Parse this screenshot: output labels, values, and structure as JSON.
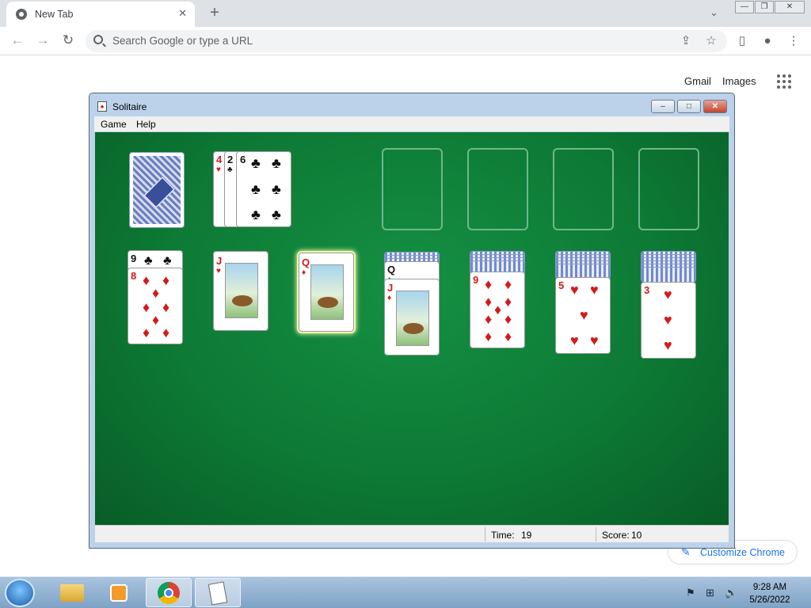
{
  "browser": {
    "tab_title": "New Tab",
    "tab_close": "✕",
    "new_tab": "+",
    "omnibox_placeholder": "Search Google or type a URL",
    "ntp_links": [
      "Gmail",
      "Images"
    ],
    "customize_label": "Customize Chrome"
  },
  "solitaire": {
    "title": "Solitaire",
    "menu": [
      "Game",
      "Help"
    ],
    "status": {
      "time_label": "Time:",
      "time_value": "19",
      "score_label": "Score:",
      "score_value": "10"
    },
    "waste": [
      {
        "rank": "4",
        "suit": "♥",
        "color": "red"
      },
      {
        "rank": "2",
        "suit": "♣",
        "color": "black"
      },
      {
        "rank": "6",
        "suit": "♣",
        "color": "black"
      }
    ],
    "tableau": [
      {
        "hidden": 0,
        "cards": [
          {
            "rank": "9",
            "suit": "♣",
            "color": "black"
          },
          {
            "rank": "8",
            "suit": "♦",
            "color": "red"
          }
        ]
      },
      {
        "hidden": 0,
        "cards": [
          {
            "rank": "J",
            "suit": "♥",
            "color": "red"
          }
        ]
      },
      {
        "hidden": 0,
        "cards": [
          {
            "rank": "Q",
            "suit": "♦",
            "color": "red"
          }
        ],
        "selected": true
      },
      {
        "hidden": 3,
        "cards": [
          {
            "rank": "Q",
            "suit": "♠",
            "color": "black"
          },
          {
            "rank": "J",
            "suit": "♦",
            "color": "red"
          }
        ]
      },
      {
        "hidden": 4,
        "cards": [
          {
            "rank": "9",
            "suit": "♦",
            "color": "red"
          }
        ]
      },
      {
        "hidden": 5,
        "cards": [
          {
            "rank": "5",
            "suit": "♥",
            "color": "red"
          }
        ]
      },
      {
        "hidden": 6,
        "cards": [
          {
            "rank": "3",
            "suit": "♥",
            "color": "red"
          }
        ]
      }
    ]
  },
  "taskbar": {
    "time": "9:28 AM",
    "date": "5/26/2022"
  }
}
